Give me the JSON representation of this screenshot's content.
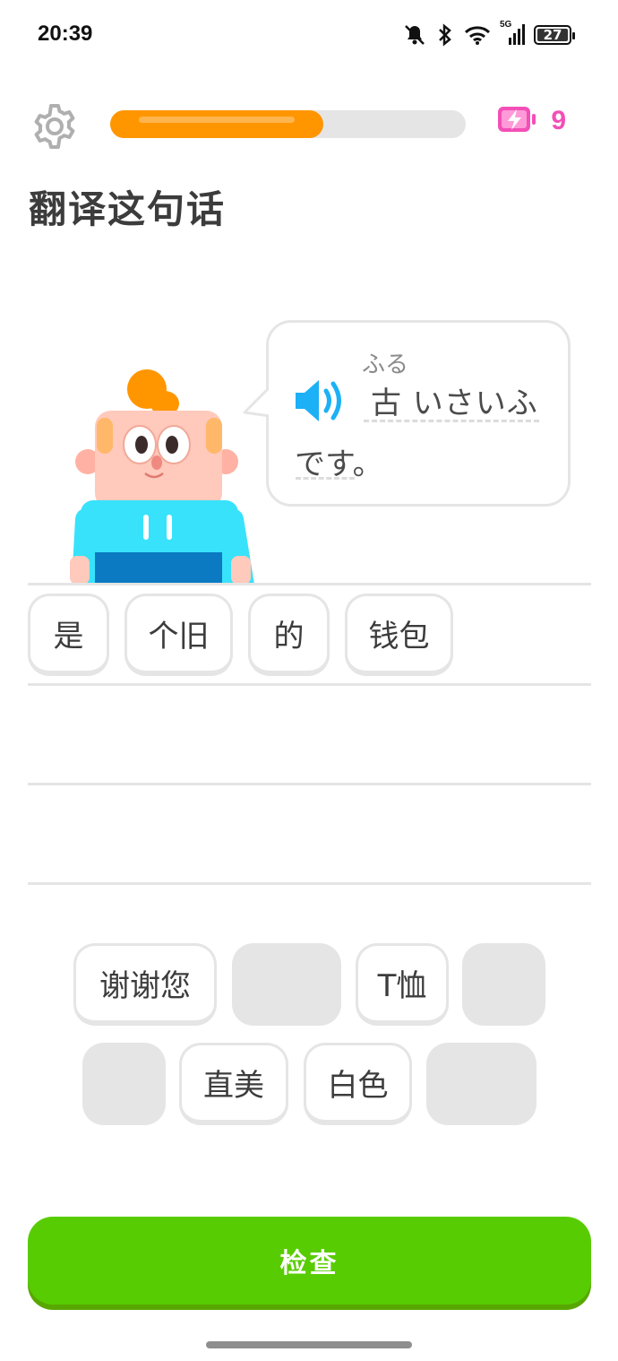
{
  "status_bar": {
    "time": "20:39",
    "network": "5G",
    "battery": "27",
    "icons": [
      "mute-icon",
      "bluetooth-icon",
      "wifi-icon",
      "signal-icon",
      "battery-icon"
    ]
  },
  "top_bar": {
    "progress": 0.6,
    "energy_count": "9"
  },
  "title": "翻译这句话",
  "prompt": {
    "furigana": "ふる",
    "line1": "古 いさいふ",
    "line2": "です。"
  },
  "answer_chips": [
    "是",
    "个旧",
    "的",
    "钱包"
  ],
  "word_bank": {
    "row1": [
      "谢谢您",
      "",
      "T恤",
      ""
    ],
    "row2": [
      "",
      "直美",
      "白色",
      ""
    ]
  },
  "check_button": "检查",
  "colors": {
    "accent_orange": "#ff9600",
    "energy_pink": "#f34fb7",
    "check_green": "#58cc02",
    "speaker_blue": "#1cb0f6"
  }
}
